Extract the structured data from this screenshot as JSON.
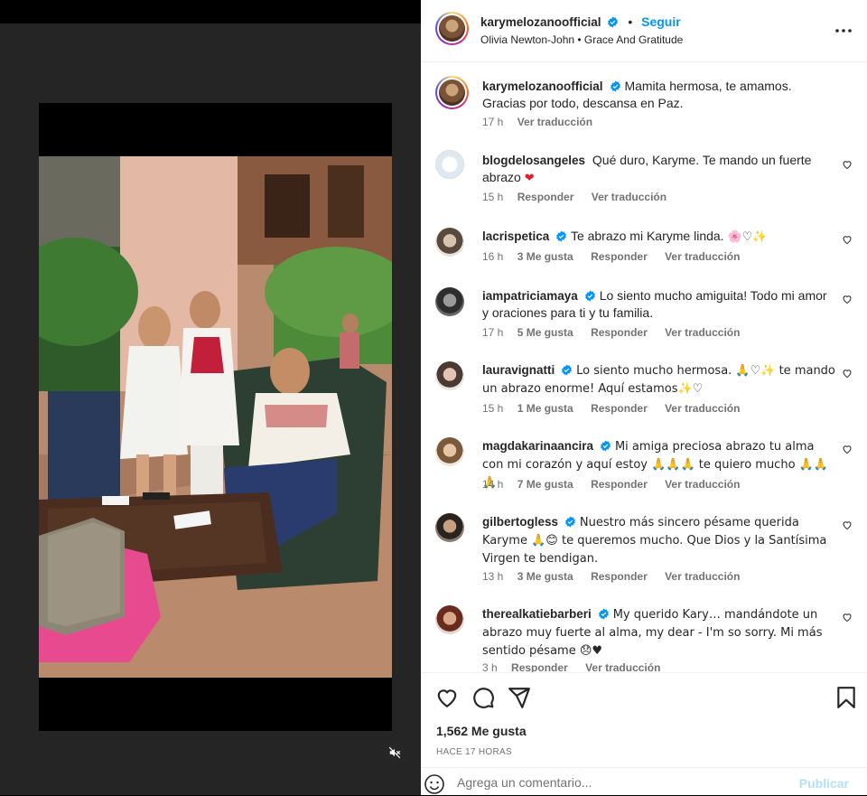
{
  "post": {
    "username": "karymelozanoofficial",
    "follow_label": "Seguir",
    "separator": "•",
    "audio": "Olivia Newton-John • Grace And Gratitude",
    "caption": "Mamita hermosa, te amamos. Gracias por todo, descansa en Paz.",
    "caption_time": "17 h",
    "caption_translate": "Ver traducción"
  },
  "comments": [
    {
      "user": "blogdelosangeles",
      "text": "Qué duro, Karyme. Te mando un fuerte abrazo",
      "emoji": "❤",
      "time": "15 h",
      "likes": "",
      "reply": "Responder",
      "translate": "Ver traducción"
    },
    {
      "user": "lacrispetica",
      "text": "Te abrazo mi Karyme linda.",
      "emoji": "🌸♡✨",
      "time": "16 h",
      "likes": "3 Me gusta",
      "reply": "Responder",
      "translate": "Ver traducción"
    },
    {
      "user": "iampatriciamaya",
      "text": "Lo siento mucho amiguita! Todo mi amor y oraciones para ti y tu familia.",
      "emoji": "",
      "time": "17 h",
      "likes": "5 Me gusta",
      "reply": "Responder",
      "translate": "Ver traducción"
    },
    {
      "user": "lauravignatti",
      "text": "Lo siento mucho hermosa. 🙏♡✨ te mando un abrazo enorme! Aquí estamos✨♡",
      "emoji": "",
      "time": "15 h",
      "likes": "1 Me gusta",
      "reply": "Responder",
      "translate": "Ver traducción"
    },
    {
      "user": "magdakarinaancira",
      "text": "Mi amiga preciosa abrazo tu alma con mi corazón y aquí estoy 🙏🙏🙏 te quiero mucho 🙏🙏🙏",
      "emoji": "",
      "time": "14 h",
      "likes": "7 Me gusta",
      "reply": "Responder",
      "translate": "Ver traducción"
    },
    {
      "user": "gilbertogless",
      "text": "Nuestro más sincero pésame querida Karyme 🙏😊 te queremos mucho. Que Dios y la Santísima Virgen te bendigan.",
      "emoji": "",
      "time": "13 h",
      "likes": "3 Me gusta",
      "reply": "Responder",
      "translate": "Ver traducción"
    },
    {
      "user": "therealkatiebarberi",
      "text": "My querido Kary… mandándote un abrazo muy fuerte al alma, my dear - I'm so sorry. Mi más sentido pésame 😞♥",
      "emoji": "",
      "time": "3 h",
      "likes": "",
      "reply": "Responder",
      "translate": "Ver traducción"
    }
  ],
  "footer": {
    "likes": "1,562 Me gusta",
    "time_ago": "HACE 17 HORAS",
    "comment_placeholder": "Agrega un comentario...",
    "publish": "Publicar"
  },
  "colors": {
    "accent": "#0095f6",
    "publish_disabled": "#b2dffc",
    "verified": "#0095f6",
    "heart_red": "#ed1c24"
  },
  "icons": [
    "heart-icon",
    "comment-icon",
    "share-icon",
    "bookmark-icon",
    "more-icon",
    "mute-icon",
    "emoji-icon",
    "verified-icon"
  ]
}
